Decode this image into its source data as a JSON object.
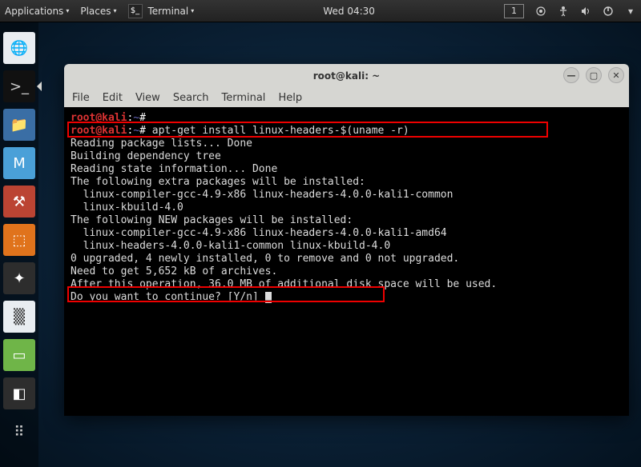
{
  "top_panel": {
    "applications": "Applications",
    "places": "Places",
    "active_app": "Terminal",
    "clock": "Wed 04:30",
    "workspace": "1"
  },
  "window": {
    "title": "root@kali: ~",
    "menubar": [
      "File",
      "Edit",
      "View",
      "Search",
      "Terminal",
      "Help"
    ]
  },
  "prompt": {
    "user": "root",
    "host": "kali",
    "path": "~",
    "symbol": "#"
  },
  "terminal": {
    "cmd1": "",
    "cmd2": "apt-get install linux-headers-$(uname -r)",
    "lines": [
      "Reading package lists... Done",
      "Building dependency tree",
      "Reading state information... Done",
      "The following extra packages will be installed:",
      "  linux-compiler-gcc-4.9-x86 linux-headers-4.0.0-kali1-common",
      "  linux-kbuild-4.0",
      "The following NEW packages will be installed:",
      "  linux-compiler-gcc-4.9-x86 linux-headers-4.0.0-kali1-amd64",
      "  linux-headers-4.0.0-kali1-common linux-kbuild-4.0",
      "0 upgraded, 4 newly installed, 0 to remove and 0 not upgraded.",
      "Need to get 5,652 kB of archives.",
      "After this operation, 36.0 MB of additional disk space will be used.",
      "Do you want to continue? [Y/n] "
    ]
  },
  "dock": {
    "items": [
      {
        "name": "iceweasel-icon",
        "label": "🌐"
      },
      {
        "name": "terminal-dock-icon",
        "label": ">_"
      },
      {
        "name": "files-icon",
        "label": "📁"
      },
      {
        "name": "metasploit-icon",
        "label": "M"
      },
      {
        "name": "armitage-icon",
        "label": "⚒"
      },
      {
        "name": "burp-icon",
        "label": "⬚"
      },
      {
        "name": "maltego-icon",
        "label": "✦"
      },
      {
        "name": "wireshark-icon",
        "label": "▒"
      },
      {
        "name": "leafpad-icon",
        "label": "▭"
      },
      {
        "name": "tweaks-icon",
        "label": "◧"
      },
      {
        "name": "show-apps-icon",
        "label": "⠿"
      }
    ]
  }
}
